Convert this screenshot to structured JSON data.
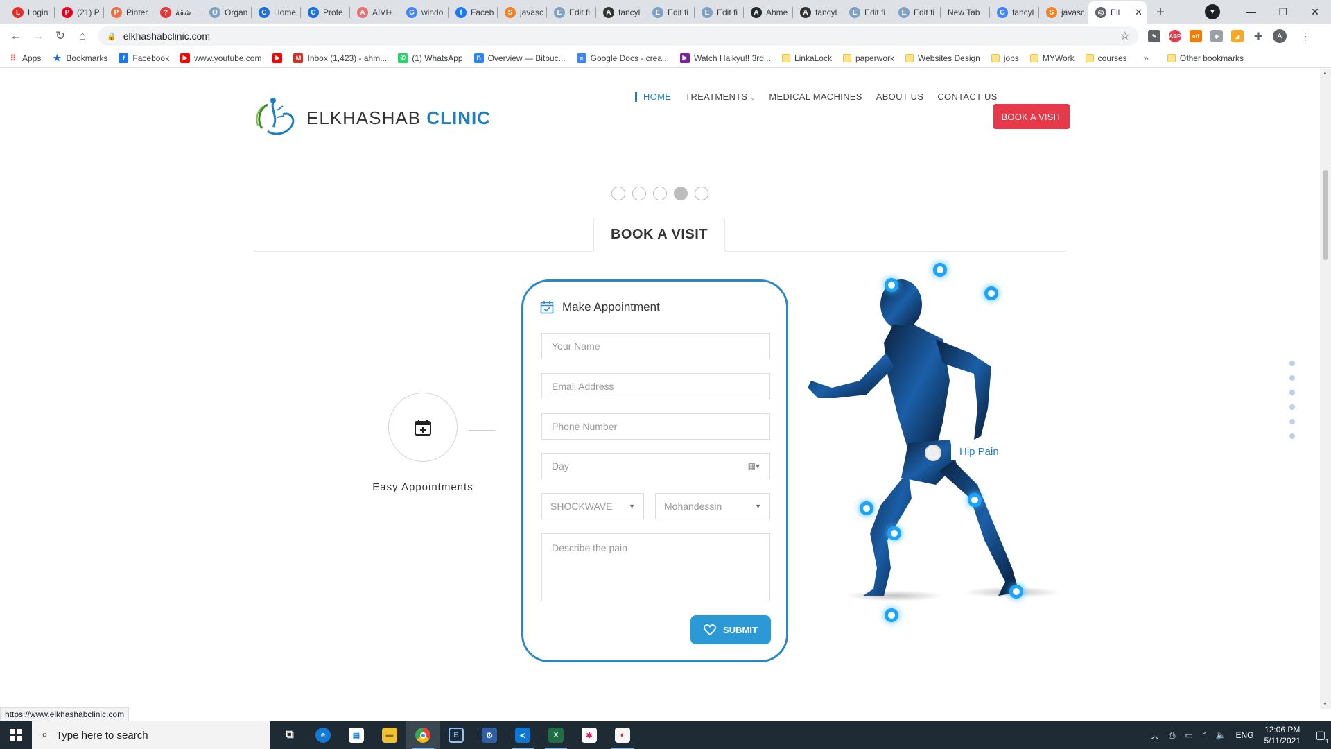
{
  "browser": {
    "tabs": [
      {
        "title": "Login",
        "color": "#e52d27",
        "glyph": "L"
      },
      {
        "title": "(21) P",
        "color": "#e60023",
        "glyph": "P"
      },
      {
        "title": "Pinter",
        "color": "#e8734a",
        "glyph": "P"
      },
      {
        "title": "شقة",
        "color": "#e6393a",
        "glyph": "?"
      },
      {
        "title": "Organ",
        "color": "#7ea1c4",
        "glyph": "O"
      },
      {
        "title": "Home",
        "color": "#1d6fd8",
        "glyph": "C"
      },
      {
        "title": "Profe",
        "color": "#1d6fd8",
        "glyph": "C"
      },
      {
        "title": "AIVI+",
        "color": "#e57373",
        "glyph": "A"
      },
      {
        "title": "windo",
        "color": "#4285f4",
        "glyph": "G"
      },
      {
        "title": "Faceb",
        "color": "#1877f2",
        "glyph": "f"
      },
      {
        "title": "javasc",
        "color": "#f48024",
        "glyph": "S"
      },
      {
        "title": "Edit fi",
        "color": "#7ea1c4",
        "glyph": "E"
      },
      {
        "title": "fancyl",
        "color": "#333333",
        "glyph": "A"
      },
      {
        "title": "Edit fi",
        "color": "#7ea1c4",
        "glyph": "E"
      },
      {
        "title": "Edit fi",
        "color": "#7ea1c4",
        "glyph": "E"
      },
      {
        "title": "Ahme",
        "color": "#24292e",
        "glyph": "A"
      },
      {
        "title": "fancyl",
        "color": "#333333",
        "glyph": "A"
      },
      {
        "title": "Edit fi",
        "color": "#7ea1c4",
        "glyph": "E"
      },
      {
        "title": "Edit fi",
        "color": "#7ea1c4",
        "glyph": "E"
      },
      {
        "title": "New Tab",
        "color": "",
        "glyph": ""
      },
      {
        "title": "fancyl",
        "color": "#4285f4",
        "glyph": "G"
      },
      {
        "title": "javasc",
        "color": "#f48024",
        "glyph": "S"
      }
    ],
    "active_tab": {
      "title": "Ell",
      "color": "#5f6368",
      "glyph": "◎"
    },
    "url": "elkhashabclinic.com",
    "status_url": "https://www.elkhashabclinic.com",
    "bookmarks": [
      {
        "label": "Apps",
        "type": "apps",
        "color": "#e8453c"
      },
      {
        "label": "Bookmarks",
        "type": "star",
        "color": "#1a73e8"
      },
      {
        "label": "Facebook",
        "type": "icon",
        "color": "#1877f2",
        "glyph": "f"
      },
      {
        "label": "www.youtube.com",
        "type": "icon",
        "color": "#ff0000",
        "glyph": "▶"
      },
      {
        "label": "",
        "type": "icon",
        "color": "#ff0000",
        "glyph": "▶"
      },
      {
        "label": "Inbox (1,423) - ahm...",
        "type": "icon",
        "color": "#d93025",
        "glyph": "M"
      },
      {
        "label": "(1) WhatsApp",
        "type": "icon",
        "color": "#25d366",
        "glyph": "✆"
      },
      {
        "label": "Overview — Bitbuc...",
        "type": "icon",
        "color": "#2684ff",
        "glyph": "B"
      },
      {
        "label": "Google Docs - crea...",
        "type": "icon",
        "color": "#4285f4",
        "glyph": "≡"
      },
      {
        "label": "Watch Haikyu!! 3rd...",
        "type": "icon",
        "color": "#7b1fa2",
        "glyph": "▶"
      },
      {
        "label": "LinkaLock",
        "type": "folder"
      },
      {
        "label": "paperwork",
        "type": "folder"
      },
      {
        "label": "Websites Design",
        "type": "folder"
      },
      {
        "label": "jobs",
        "type": "folder"
      },
      {
        "label": "MYWork",
        "type": "folder"
      },
      {
        "label": "courses",
        "type": "folder"
      }
    ],
    "more": "»",
    "other_bookmarks": "Other bookmarks"
  },
  "site": {
    "logo": {
      "first": "ELKHASHAB",
      "second": "CLINIC"
    },
    "nav": [
      {
        "label": "HOME",
        "active": true
      },
      {
        "label": "TREATMENTS",
        "dropdown": true
      },
      {
        "label": "MEDICAL MACHINES"
      },
      {
        "label": "ABOUT US"
      },
      {
        "label": "CONTACT US"
      }
    ],
    "book_button": "BOOK A VISIT",
    "slider_active_index": 3,
    "section_title": "BOOK A VISIT",
    "feature_title": "Easy Appointments",
    "form": {
      "heading": "Make Appointment",
      "name_placeholder": "Your Name",
      "email_placeholder": "Email Address",
      "phone_placeholder": "Phone Number",
      "day_placeholder": "Day",
      "treatment_selected": "SHOCKWAVE",
      "branch_selected": "Mohandessin",
      "describe_placeholder": "Describe the pain",
      "submit_label": "SUBMIT"
    },
    "hotspot_label": "Hip Pain",
    "colors": {
      "accent": "#1f7fc1",
      "book": "#e8394a",
      "submit": "#2b99d6",
      "card_border": "#2b88c8"
    }
  },
  "taskbar": {
    "search_placeholder": "Type here to search",
    "language": "ENG",
    "time": "12:06 PM",
    "date": "5/11/2021",
    "notifications": "1"
  }
}
